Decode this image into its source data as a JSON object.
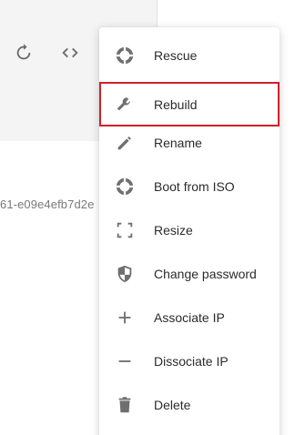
{
  "background": {
    "server_id_fragment": "61-e09e4efb7d2e"
  },
  "toolbar": {
    "refresh_icon": "refresh-icon",
    "code_icon": "code-icon"
  },
  "menu": {
    "highlight_color": "#d0202a",
    "items": [
      {
        "label": "Rescue",
        "icon": "lifebuoy-icon",
        "highlighted": false
      },
      {
        "label": "Rebuild",
        "icon": "wrench-icon",
        "highlighted": true
      },
      {
        "label": "Rename",
        "icon": "pencil-icon",
        "highlighted": false
      },
      {
        "label": "Boot from ISO",
        "icon": "lifebuoy-icon",
        "highlighted": false
      },
      {
        "label": "Resize",
        "icon": "resize-icon",
        "highlighted": false
      },
      {
        "label": "Change password",
        "icon": "shield-icon",
        "highlighted": false
      },
      {
        "label": "Associate IP",
        "icon": "plus-icon",
        "highlighted": false
      },
      {
        "label": "Dissociate IP",
        "icon": "minus-icon",
        "highlighted": false
      },
      {
        "label": "Delete",
        "icon": "trash-icon",
        "highlighted": false
      }
    ]
  }
}
